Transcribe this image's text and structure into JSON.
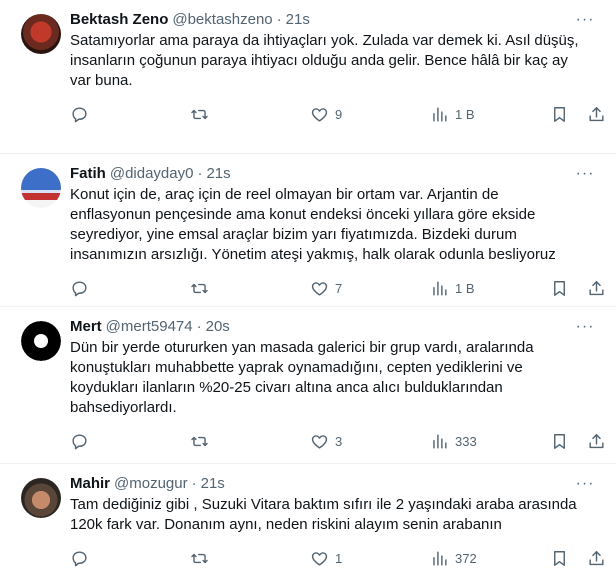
{
  "tweets": [
    {
      "name": "Bektash Zeno",
      "handle": "@bektashzeno",
      "time": "21s",
      "text": "Satamıyorlar ama paraya da ihtiyaçları yok. Zulada var demek ki. Asıl düşüş,\ninsanların çoğunun paraya ihtiyacı olduğu anda gelir. Bence hâlâ bir kaç ay\nvar buna.",
      "likes": "9",
      "views": "1 B"
    },
    {
      "name": "Fatih",
      "handle": "@didayday0",
      "time": "21s",
      "text": "Konut için de, araç için de reel olmayan bir ortam var. Arjantin de\nenflasyonun pençesinde ama konut endeksi önceki yıllara göre ekside\nseyrediyor, yine emsal araçlar bizim yarı fiyatımızda. Bizdeki durum\ninsanımızın arsızlığı. Yönetim ateşi yakmış, halk olarak odunla besliyoruz",
      "likes": "7",
      "views": "1 B"
    },
    {
      "name": "Mert",
      "handle": "@mert59474",
      "time": "20s",
      "text": "Dün bir yerde otururken yan masada galerici bir grup vardı, aralarında\nkonuştukları muhabbette yaprak oynamadığını, cepten yediklerini ve\nkoydukları ilanların %20-25 civarı altına anca alıcı bulduklarından\nbahsediyorlardı.",
      "likes": "3",
      "views": "333"
    },
    {
      "name": "Mahir",
      "handle": "@mozugur",
      "time": "21s",
      "text": "Tam dediğiniz gibi , Suzuki Vitara baktım sıfırı ile 2 yaşındaki araba arasında\n120k fark var. Donanım aynı, neden riskini alayım senin arabanın",
      "likes": "1",
      "views": "372"
    }
  ],
  "ui": {
    "separator": "·",
    "more": "···"
  }
}
